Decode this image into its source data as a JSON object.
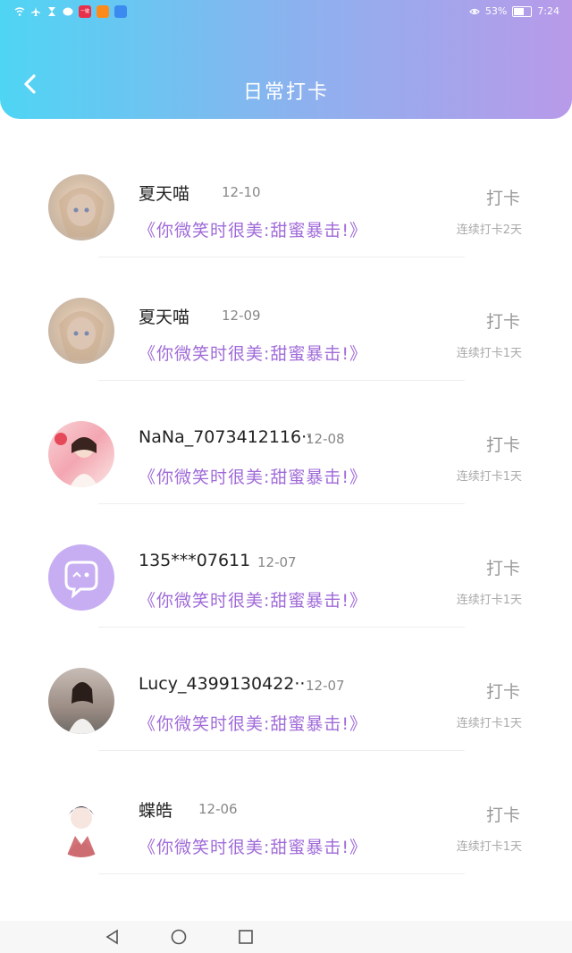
{
  "status_bar": {
    "battery": "53%",
    "time": "7:24",
    "app_badges": [
      "一键购"
    ]
  },
  "header": {
    "title": "日常打卡"
  },
  "items": [
    {
      "name": "夏天喵",
      "date": "12-10",
      "message": "《你微笑时很美:甜蜜暴击!》",
      "action": "打卡",
      "streak": "连续打卡2天",
      "avatar": "anime-girl-avatar"
    },
    {
      "name": "夏天喵",
      "date": "12-09",
      "message": "《你微笑时很美:甜蜜暴击!》",
      "action": "打卡",
      "streak": "连续打卡1天",
      "avatar": "anime-girl-avatar"
    },
    {
      "name": "NaNa_7073412116··",
      "date": "12-08",
      "message": "《你微笑时很美:甜蜜暴击!》",
      "action": "打卡",
      "streak": "连续打卡1天",
      "avatar": "photo-girl-avatar"
    },
    {
      "name": "135***07611",
      "date": "12-07",
      "message": "《你微笑时很美:甜蜜暴击!》",
      "action": "打卡",
      "streak": "连续打卡1天",
      "avatar": "default-chat-avatar"
    },
    {
      "name": "Lucy_4399130422··",
      "date": "12-07",
      "message": "《你微笑时很美:甜蜜暴击!》",
      "action": "打卡",
      "streak": "连续打卡1天",
      "avatar": "photo-woman-avatar"
    },
    {
      "name": "蝶皓",
      "date": "12-06",
      "message": "《你微笑时很美:甜蜜暴击!》",
      "action": "打卡",
      "streak": "连续打卡1天",
      "avatar": "anime-boy-avatar"
    }
  ]
}
